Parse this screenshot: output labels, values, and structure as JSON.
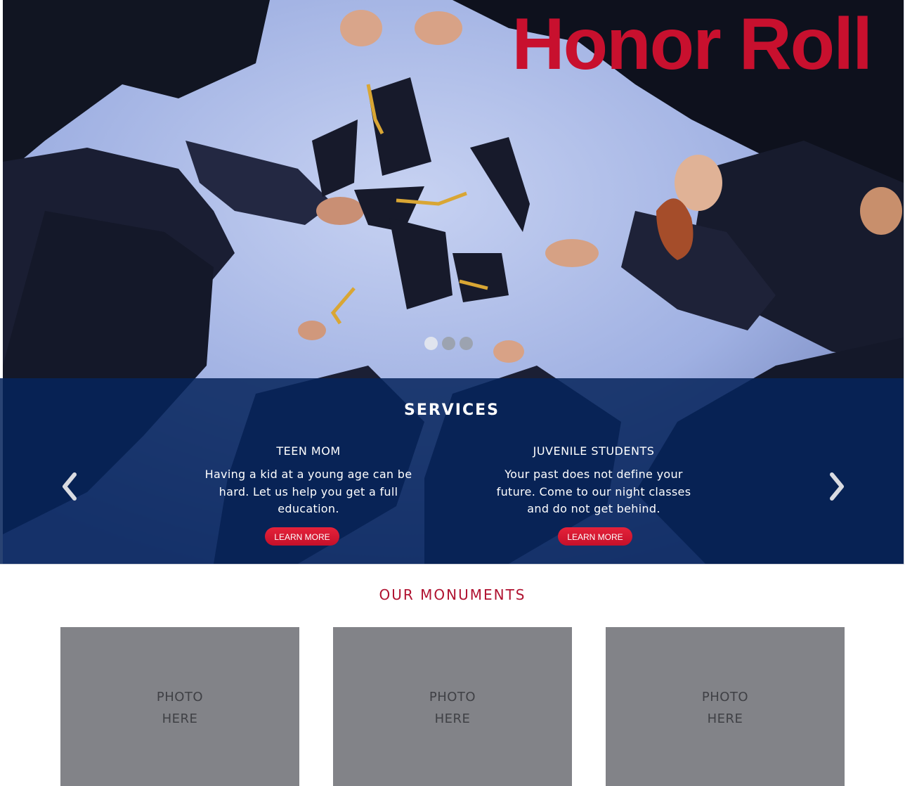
{
  "hero": {
    "title": "Honor Roll",
    "slides": 3,
    "active_slide": 1
  },
  "services": {
    "title": "SERVICES",
    "items": [
      {
        "heading": "TEEN MOM",
        "text": "Having a kid at a young age can be hard. Let us help you get a full education.",
        "button_label": "LEARN MORE"
      },
      {
        "heading": "JUVENILE STUDENTS",
        "text": "Your past does not define your future. Come to our night classes and do not get behind.",
        "button_label": "LEARN MORE"
      }
    ],
    "prev_icon": "chevron-left-icon",
    "next_icon": "chevron-right-icon"
  },
  "monuments": {
    "title": "OUR MONUMENTS",
    "cards": [
      {
        "line1": "PHOTO",
        "line2": "HERE"
      },
      {
        "line1": "PHOTO",
        "line2": "HERE"
      },
      {
        "line1": "PHOTO",
        "line2": "HERE"
      }
    ]
  },
  "colors": {
    "accent_red": "#c8102e",
    "services_bg": "#06245c",
    "placeholder_gray": "#828388",
    "monuments_title": "#b01230"
  }
}
